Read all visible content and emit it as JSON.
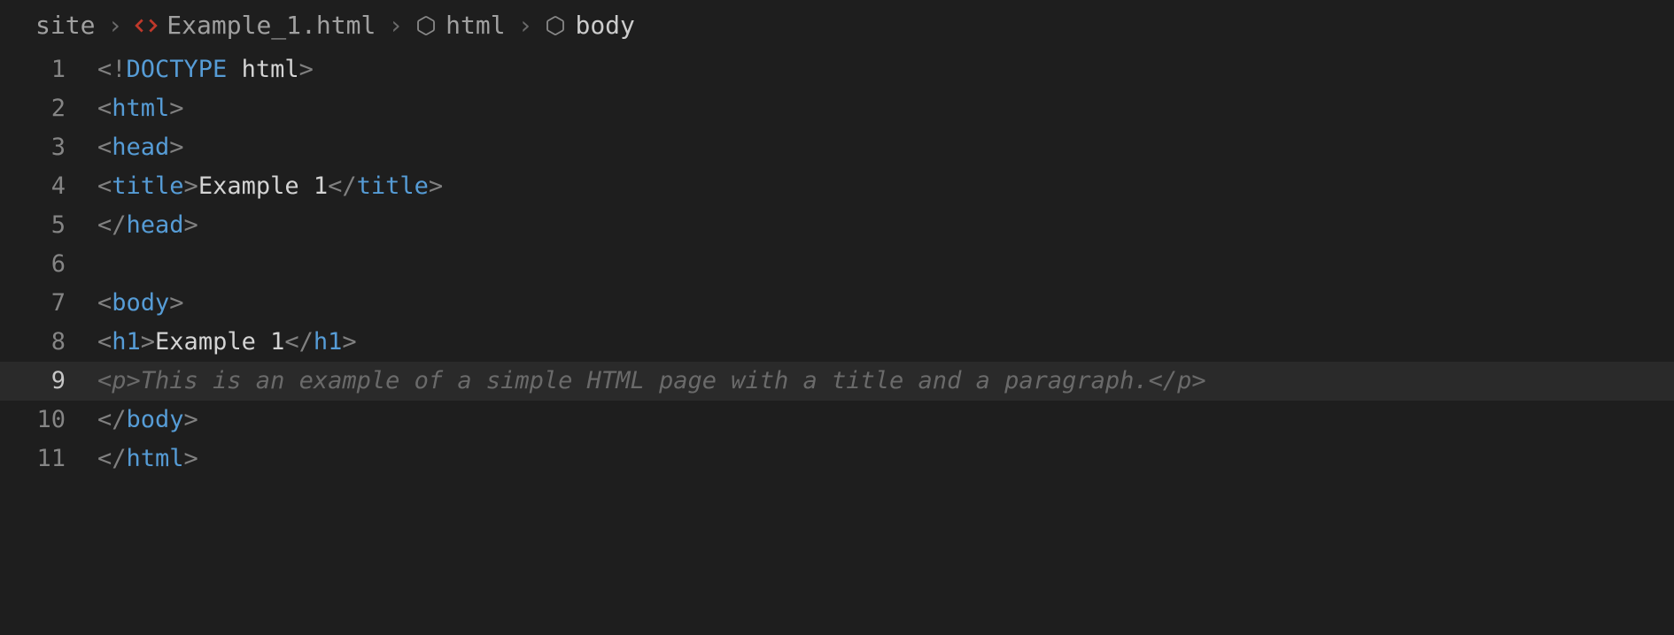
{
  "breadcrumb": {
    "items": [
      {
        "label": "site",
        "icon": null
      },
      {
        "label": "Example_1.html",
        "icon": "code"
      },
      {
        "label": "html",
        "icon": "hex"
      },
      {
        "label": "body",
        "icon": "hex"
      }
    ]
  },
  "editor": {
    "current_line": 9,
    "lines": [
      {
        "num": "1",
        "tokens": [
          {
            "t": "<!",
            "c": "pun"
          },
          {
            "t": "DOCTYPE",
            "c": "doctype"
          },
          {
            "t": " ",
            "c": "pun"
          },
          {
            "t": "html",
            "c": "html-kw"
          },
          {
            "t": ">",
            "c": "pun"
          }
        ]
      },
      {
        "num": "2",
        "tokens": [
          {
            "t": "<",
            "c": "pun"
          },
          {
            "t": "html",
            "c": "tag"
          },
          {
            "t": ">",
            "c": "pun"
          }
        ]
      },
      {
        "num": "3",
        "tokens": [
          {
            "t": "<",
            "c": "pun"
          },
          {
            "t": "head",
            "c": "tag"
          },
          {
            "t": ">",
            "c": "pun"
          }
        ]
      },
      {
        "num": "4",
        "tokens": [
          {
            "t": "<",
            "c": "pun"
          },
          {
            "t": "title",
            "c": "tag"
          },
          {
            "t": ">",
            "c": "pun"
          },
          {
            "t": "Example 1",
            "c": "text"
          },
          {
            "t": "</",
            "c": "pun"
          },
          {
            "t": "title",
            "c": "tag"
          },
          {
            "t": ">",
            "c": "pun"
          }
        ]
      },
      {
        "num": "5",
        "tokens": [
          {
            "t": "</",
            "c": "pun"
          },
          {
            "t": "head",
            "c": "tag"
          },
          {
            "t": ">",
            "c": "pun"
          }
        ]
      },
      {
        "num": "6",
        "tokens": []
      },
      {
        "num": "7",
        "tokens": [
          {
            "t": "<",
            "c": "pun"
          },
          {
            "t": "body",
            "c": "tag"
          },
          {
            "t": ">",
            "c": "pun"
          }
        ]
      },
      {
        "num": "8",
        "tokens": [
          {
            "t": "<",
            "c": "pun"
          },
          {
            "t": "h1",
            "c": "tag"
          },
          {
            "t": ">",
            "c": "pun"
          },
          {
            "t": "Example 1",
            "c": "text"
          },
          {
            "t": "</",
            "c": "pun"
          },
          {
            "t": "h1",
            "c": "tag"
          },
          {
            "t": ">",
            "c": "pun"
          }
        ]
      },
      {
        "num": "9",
        "tokens": [
          {
            "t": "<p>This is an example of a simple HTML page with a title and a paragraph.</p>",
            "c": "ghost"
          }
        ]
      },
      {
        "num": "10",
        "tokens": [
          {
            "t": "</",
            "c": "pun"
          },
          {
            "t": "body",
            "c": "tag"
          },
          {
            "t": ">",
            "c": "pun"
          }
        ]
      },
      {
        "num": "11",
        "tokens": [
          {
            "t": "</",
            "c": "pun"
          },
          {
            "t": "html",
            "c": "tag"
          },
          {
            "t": ">",
            "c": "pun"
          }
        ]
      }
    ]
  }
}
